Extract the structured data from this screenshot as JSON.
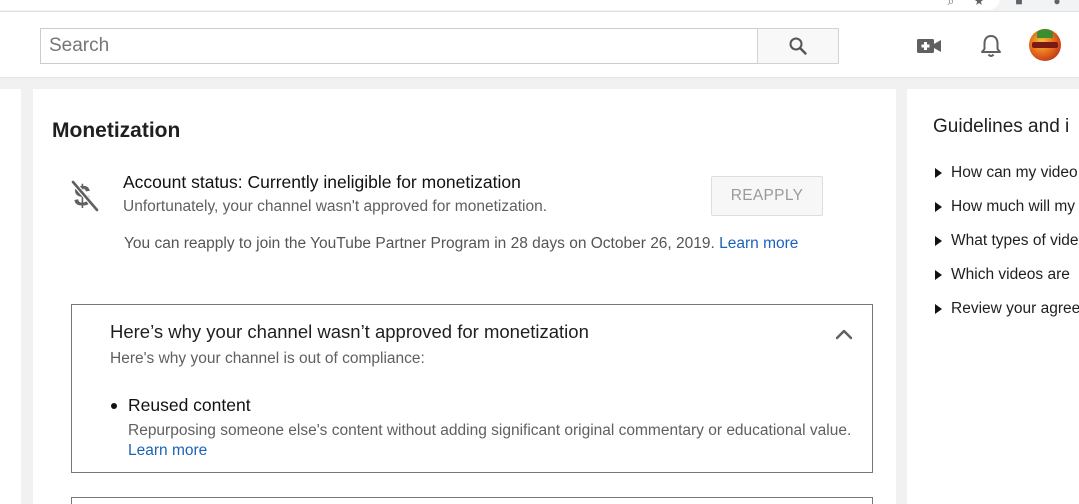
{
  "search": {
    "placeholder": "Search"
  },
  "topbar": {
    "icons": [
      "search-icon",
      "video-camera-add-icon",
      "bell-icon",
      "avatar"
    ]
  },
  "monetization": {
    "title": "Monetization",
    "icon": "no-dollar-icon",
    "status_title": "Account status: Currently ineligible for monetization",
    "status_sub": "Unfortunately, your channel wasn't approved for monetization.",
    "reapply_label": "REAPPLY",
    "reapply_text": "You can reapply to join the YouTube Partner Program in 28 days on October 26, 2019.",
    "learn_more": "Learn more"
  },
  "reasons": {
    "title": "Here’s why your channel wasn’t approved for monetization",
    "subtitle": "Here's why your channel is out of compliance:",
    "items": [
      {
        "title": "Reused content",
        "description": "Repurposing someone else's content without adding significant original commentary or educational value.",
        "link": "Learn more"
      }
    ]
  },
  "guidelines": {
    "title": "Guidelines and i",
    "items": [
      {
        "label": "How can my video"
      },
      {
        "label": "How much will my"
      },
      {
        "label": "What types of vide"
      },
      {
        "label": "Which videos are"
      },
      {
        "label": "Review your agree"
      }
    ]
  },
  "colors": {
    "link": "#1c62b9",
    "page_bg": "#f1f1f1",
    "card_bg": "#ffffff",
    "muted_text": "#606060"
  }
}
